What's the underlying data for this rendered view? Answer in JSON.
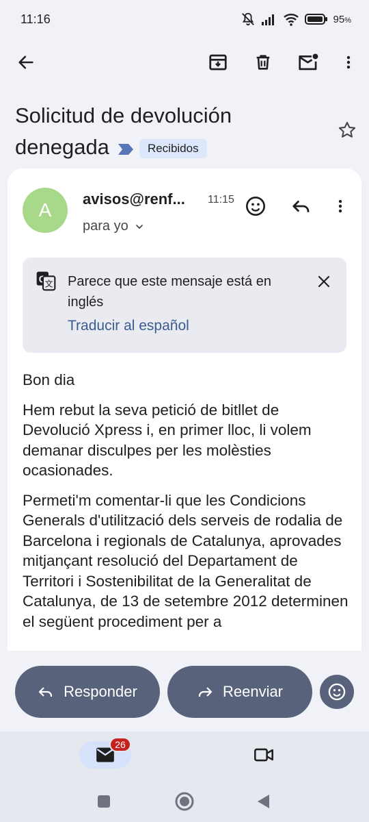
{
  "status": {
    "time": "11:16",
    "battery": "95",
    "battery_suffix": "%"
  },
  "toolbar": {
    "back_icon": "arrow-back-icon",
    "archive_icon": "archive-icon",
    "delete_icon": "trash-icon",
    "mark_unread_icon": "mail-unread-icon",
    "more_icon": "more-vertical-icon"
  },
  "email": {
    "subject_line1": "Solicitud de devolución",
    "subject_line2": "denegada",
    "label": "Recibidos",
    "sender": "avisos@renf...",
    "avatar_letter": "A",
    "time": "11:15",
    "recipient": "para yo"
  },
  "translate": {
    "message": "Parece que este mensaje está en inglés",
    "action": "Traducir al español"
  },
  "body": {
    "greeting": "Bon dia",
    "paragraph1": "Hem rebut la seva petició de bitllet de Devolució Xpress i, en primer lloc, li volem demanar disculpes per les molèsties ocasionades.",
    "paragraph2": "Permeti'm comentar-li que les Condicions Generals d'utilització dels serveis de rodalia de Barcelona i regionals de Catalunya, aprovades mitjançant resolució del Departament de Territori i Sostenibilitat de la Generalitat de Catalunya, de 13 de setembre 2012 determinen el següent procediment per a"
  },
  "actions": {
    "reply": "Responder",
    "forward": "Reenviar"
  },
  "nav": {
    "mail_badge": "26"
  },
  "colors": {
    "accent_pill": "#58627a",
    "label_chip": "#dce7fb",
    "avatar": "#a8d98a",
    "badge": "#c5221f",
    "link": "#3a5c8f"
  }
}
